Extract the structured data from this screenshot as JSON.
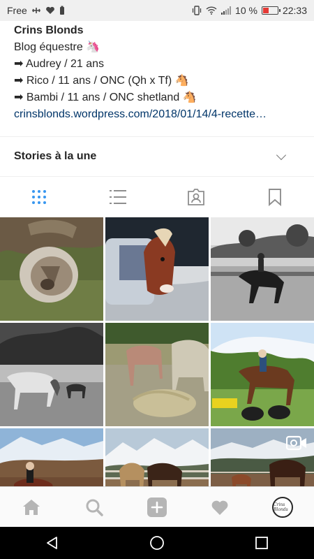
{
  "status_bar": {
    "carrier": "Free",
    "icons_left": [
      "usb-icon",
      "heart-icon",
      "battery-saver-icon"
    ],
    "icons_right": [
      "vibrate-icon",
      "wifi-icon",
      "signal-icon"
    ],
    "battery_percent": "10 %",
    "battery_level": 0.1,
    "time": "22:33"
  },
  "profile": {
    "name": "Crins Blonds",
    "bio_lines": [
      "Blog équestre 🦄",
      "➡ Audrey / 21 ans",
      "➡ Rico / 11 ans / ONC (Qh x Tf) 🐴",
      "➡ Bambi / 11 ans / ONC shetland 🐴"
    ],
    "link": "crinsblonds.wordpress.com/2018/01/14/4-recette…"
  },
  "highlights": {
    "title": "Stories à la une"
  },
  "tabs": [
    {
      "name": "grid",
      "icon": "grid-icon",
      "active": true
    },
    {
      "name": "list",
      "icon": "list-icon",
      "active": false
    },
    {
      "name": "tagged",
      "icon": "tagged-icon",
      "active": false
    },
    {
      "name": "saved",
      "icon": "bookmark-icon",
      "active": false
    }
  ],
  "posts": [
    {
      "subject": "hoof-closeup",
      "icon": ""
    },
    {
      "subject": "horse-with-blanket-snow",
      "icon": ""
    },
    {
      "subject": "horse-rider-bw",
      "icon": ""
    },
    {
      "subject": "horse-blanket-paddock-bw",
      "icon": ""
    },
    {
      "subject": "horses-eating-hay",
      "icon": ""
    },
    {
      "subject": "rider-jumping-tires",
      "icon": ""
    },
    {
      "subject": "rider-mountains",
      "icon": ""
    },
    {
      "subject": "horses-snow-mountains",
      "icon": ""
    },
    {
      "subject": "horse-video",
      "icon": "video-icon"
    }
  ],
  "bottom_nav": [
    "home-icon",
    "search-icon",
    "add-post-icon",
    "activity-icon",
    "profile-avatar"
  ],
  "avatar_text": "Crins Blonds",
  "system_nav": [
    "back-icon",
    "home-circle-icon",
    "recents-icon"
  ],
  "colors": {
    "link": "#003569",
    "active_tab": "#3897f0",
    "inactive_icon": "#8e8e8e",
    "battery_low": "#e53935"
  }
}
